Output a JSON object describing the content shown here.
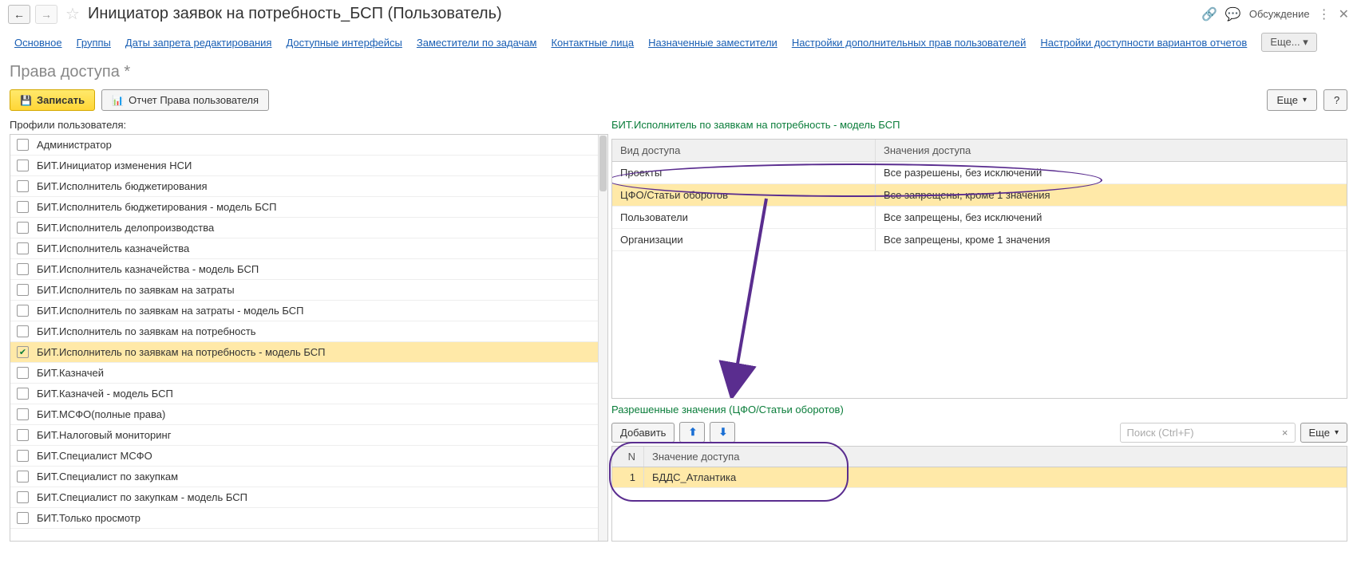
{
  "header": {
    "title": "Инициатор заявок на потребность_БСП (Пользователь)",
    "discuss": "Обсуждение"
  },
  "nav": {
    "items": [
      "Основное",
      "Группы",
      "Даты запрета редактирования",
      "Доступные интерфейсы",
      "Заместители по задачам",
      "Контактные лица",
      "Назначенные заместители",
      "Настройки дополнительных прав пользователей",
      "Настройки доступности вариантов отчетов"
    ],
    "more": "Еще..."
  },
  "section": {
    "title": "Права доступа *"
  },
  "toolbar": {
    "save": "Записать",
    "report": "Отчет Права пользователя",
    "more": "Еще",
    "help": "?"
  },
  "profiles": {
    "label": "Профили пользователя:",
    "items": [
      {
        "label": "Администратор",
        "checked": false
      },
      {
        "label": "БИТ.Инициатор изменения НСИ",
        "checked": false
      },
      {
        "label": "БИТ.Исполнитель бюджетирования",
        "checked": false
      },
      {
        "label": "БИТ.Исполнитель бюджетирования - модель БСП",
        "checked": false
      },
      {
        "label": "БИТ.Исполнитель делопроизводства",
        "checked": false
      },
      {
        "label": "БИТ.Исполнитель казначейства",
        "checked": false
      },
      {
        "label": "БИТ.Исполнитель казначейства - модель БСП",
        "checked": false
      },
      {
        "label": "БИТ.Исполнитель по заявкам на затраты",
        "checked": false
      },
      {
        "label": "БИТ.Исполнитель по заявкам на затраты - модель БСП",
        "checked": false
      },
      {
        "label": "БИТ.Исполнитель по заявкам на потребность",
        "checked": false
      },
      {
        "label": "БИТ.Исполнитель по заявкам на потребность - модель БСП",
        "checked": true,
        "selected": true
      },
      {
        "label": "БИТ.Казначей",
        "checked": false
      },
      {
        "label": "БИТ.Казначей - модель БСП",
        "checked": false
      },
      {
        "label": "БИТ.МСФО(полные права)",
        "checked": false
      },
      {
        "label": "БИТ.Налоговый мониторинг",
        "checked": false
      },
      {
        "label": "БИТ.Специалист МСФО",
        "checked": false
      },
      {
        "label": "БИТ.Специалист по закупкам",
        "checked": false
      },
      {
        "label": "БИТ.Специалист по закупкам - модель БСП",
        "checked": false
      },
      {
        "label": "БИТ.Только просмотр",
        "checked": false
      }
    ]
  },
  "access": {
    "label": "БИТ.Исполнитель по заявкам на потребность - модель БСП",
    "head_type": "Вид доступа",
    "head_val": "Значения доступа",
    "rows": [
      {
        "type": "Проекты",
        "val": "Все разрешены, без исключений",
        "selected": false
      },
      {
        "type": "ЦФО/Статьи оборотов",
        "val": "Все запрещены, кроме 1 значения",
        "selected": true
      },
      {
        "type": "Пользователи",
        "val": "Все запрещены, без исключений",
        "selected": false
      },
      {
        "type": "Организации",
        "val": "Все запрещены, кроме 1 значения",
        "selected": false
      }
    ]
  },
  "allowed": {
    "label": "Разрешенные значения (ЦФО/Статьи оборотов)",
    "add": "Добавить",
    "search_placeholder": "Поиск (Ctrl+F)",
    "more": "Еще",
    "head_n": "N",
    "head_val": "Значение доступа",
    "rows": [
      {
        "n": "1",
        "val": "БДДС_Атлантика",
        "selected": true
      }
    ]
  }
}
